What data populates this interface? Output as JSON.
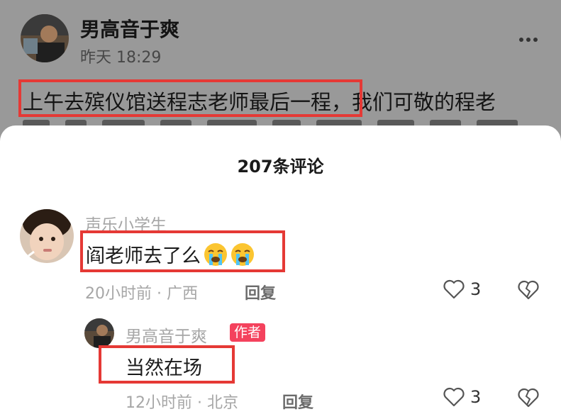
{
  "post": {
    "author": "男高音于爽",
    "time": "昨天 18:29",
    "text": "上午去殡仪馆送程志老师最后一程，我们可敬的程老",
    "more_icon": "more-horizontal-icon"
  },
  "sheet": {
    "title": "207条评论"
  },
  "comments": [
    {
      "name": "声乐小学生",
      "text": "阎老师去了么",
      "emoji": "loudly-crying-face-icon",
      "time": "20小时前 · 广西",
      "reply_label": "回复",
      "likes": "3"
    },
    {
      "name": "男高音于爽",
      "badge": "作者",
      "text": "当然在场",
      "time": "12小时前 · 北京",
      "reply_label": "回复",
      "likes": "3"
    }
  ],
  "colors": {
    "highlight": "#e53935",
    "author_badge": "#f4425d",
    "overlay": "#999999"
  }
}
